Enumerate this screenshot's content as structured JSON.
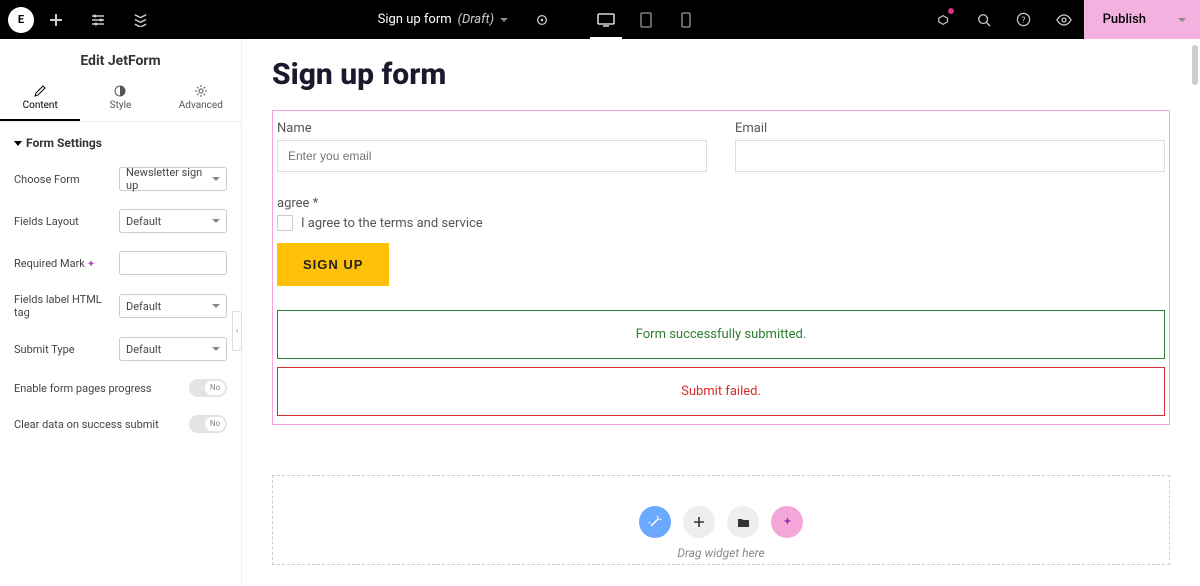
{
  "topbar": {
    "logo_text": "E",
    "title": "Sign up form",
    "status": "(Draft)",
    "publish_label": "Publish"
  },
  "sidebar": {
    "header": "Edit JetForm",
    "tabs": {
      "content": "Content",
      "style": "Style",
      "advanced": "Advanced"
    },
    "section_title": "Form Settings",
    "controls": {
      "choose_form_label": "Choose Form",
      "choose_form_value": "Newsletter sign up",
      "fields_layout_label": "Fields Layout",
      "fields_layout_value": "Default",
      "required_mark_label": "Required Mark",
      "required_mark_value": "",
      "fields_label_tag_label": "Fields label HTML tag",
      "fields_label_tag_value": "Default",
      "submit_type_label": "Submit Type",
      "submit_type_value": "Default",
      "enable_progress_label": "Enable form pages progress",
      "toggle_no": "No",
      "clear_data_label": "Clear data on success submit"
    }
  },
  "canvas": {
    "heading": "Sign up form",
    "name_label": "Name",
    "name_placeholder": "Enter you email",
    "email_label": "Email",
    "agree_label": "agree *",
    "agree_text": "I agree to the terms and service",
    "signup_label": "SIGN UP",
    "success_msg": "Form successfully submitted.",
    "error_msg": "Submit failed.",
    "drop_hint": "Drag widget here"
  }
}
